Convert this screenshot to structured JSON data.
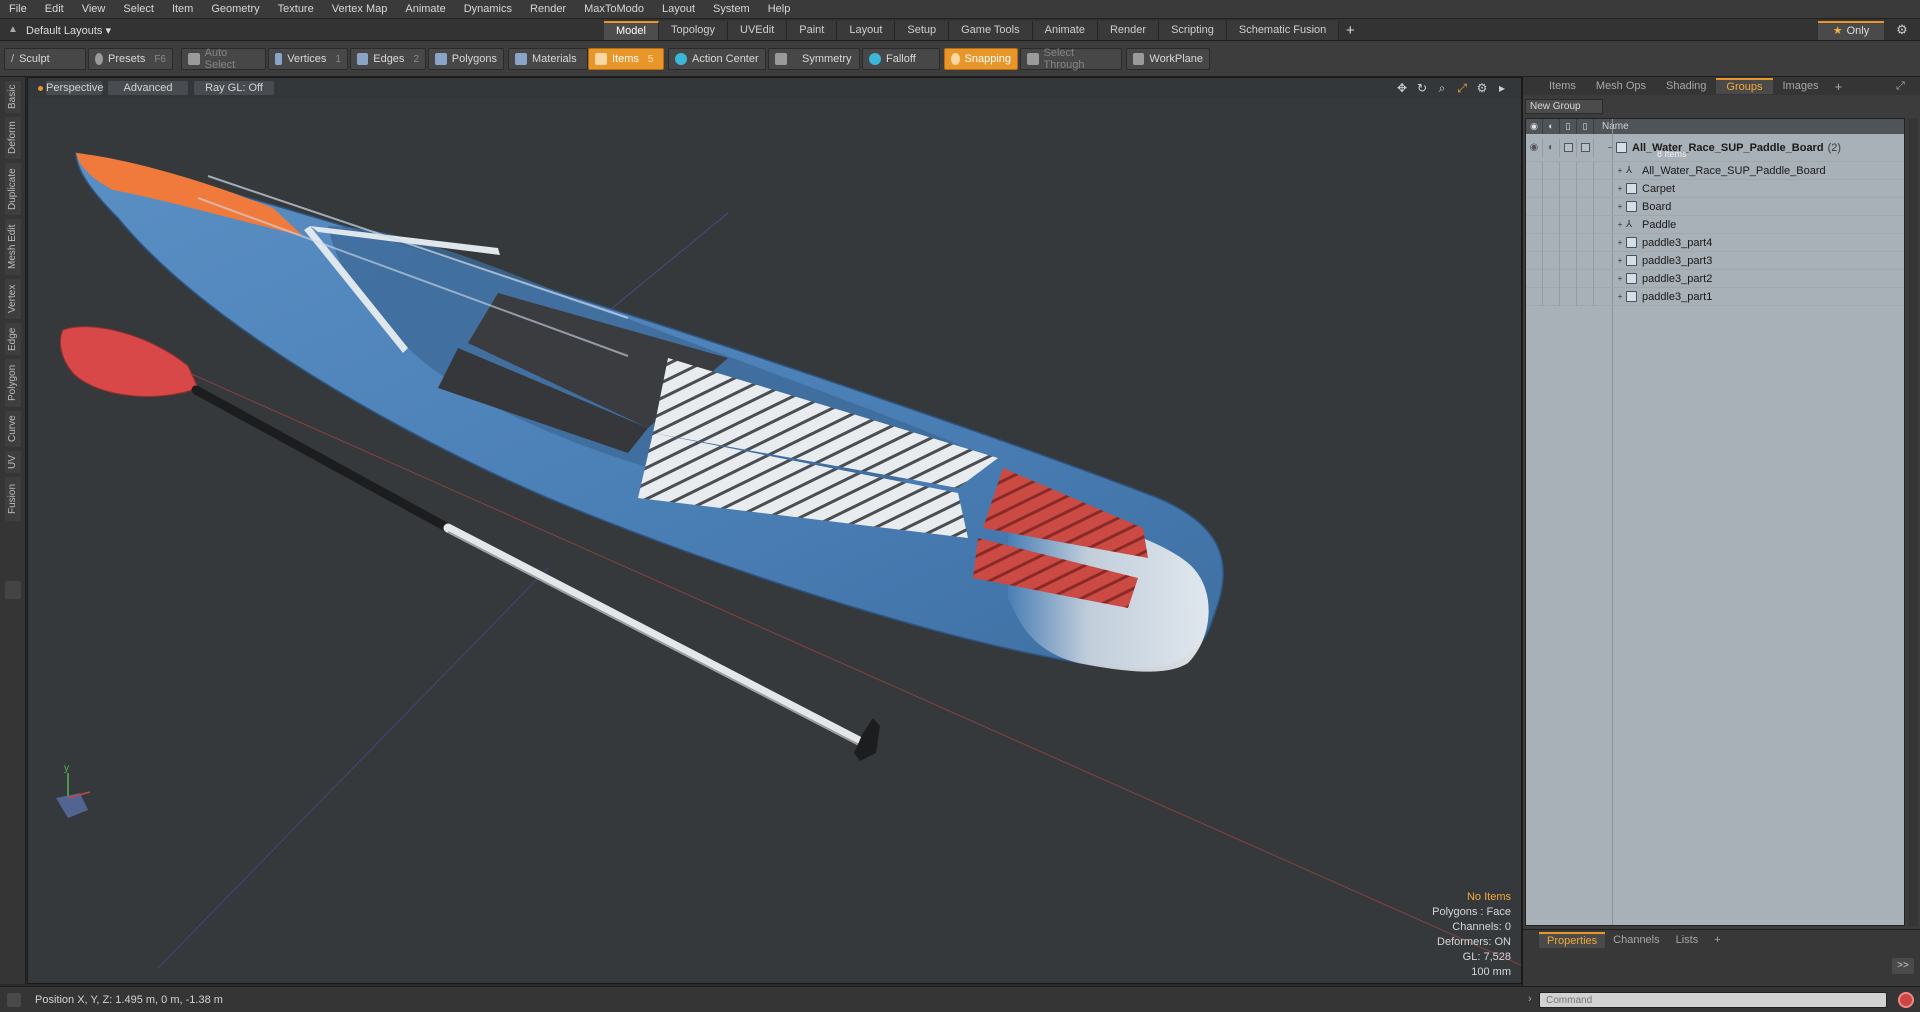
{
  "menu": [
    "File",
    "Edit",
    "View",
    "Select",
    "Item",
    "Geometry",
    "Texture",
    "Vertex Map",
    "Animate",
    "Dynamics",
    "Render",
    "MaxToModo",
    "Layout",
    "System",
    "Help"
  ],
  "layout_select": "Default Layouts ▾",
  "tabs": [
    "Model",
    "Topology",
    "UVEdit",
    "Paint",
    "Layout",
    "Setup",
    "Game Tools",
    "Animate",
    "Render",
    "Scripting",
    "Schematic Fusion"
  ],
  "active_tab": "Model",
  "only_label": "Only",
  "toolbar": {
    "sculpt": "Sculpt",
    "presets": "Presets",
    "presets_key": "F6",
    "auto_select": "Auto Select",
    "vertices": "Vertices",
    "vertices_key": "1",
    "edges": "Edges",
    "edges_key": "2",
    "polygons": "Polygons",
    "materials": "Materials",
    "items": "Items",
    "items_key": "5",
    "action_center": "Action Center",
    "symmetry": "Symmetry",
    "falloff": "Falloff",
    "snapping": "Snapping",
    "select_through": "Select Through",
    "workplane": "WorkPlane"
  },
  "left_tabs": [
    "Basic",
    "Deform",
    "Duplicate",
    "Mesh Edit",
    "Vertex",
    "Edge",
    "Polygon",
    "Curve",
    "UV",
    "Fusion"
  ],
  "viewport": {
    "perspective": "Perspective",
    "advanced": "Advanced",
    "raygl": "Ray GL: Off",
    "axis_y": "y",
    "stats": {
      "no_items": "No Items",
      "polygons": "Polygons : Face",
      "channels": "Channels: 0",
      "deformers": "Deformers: ON",
      "gl": "GL: 7,528",
      "scale": "100 mm"
    }
  },
  "status": "Position X, Y, Z:   1.495 m, 0 m, -1.38 m",
  "right_panel": {
    "tabs": [
      "Items",
      "Mesh Ops",
      "Shading",
      "Groups",
      "Images"
    ],
    "active_tab": "Groups",
    "new_group": "New Group",
    "name_header": "Name",
    "group": {
      "name": "All_Water_Race_SUP_Paddle_Board",
      "count": "(2)",
      "sub": "8 Items"
    },
    "items": [
      {
        "name": "All_Water_Race_SUP_Paddle_Board",
        "kind": "locator"
      },
      {
        "name": "Carpet",
        "kind": "mesh"
      },
      {
        "name": "Board",
        "kind": "mesh"
      },
      {
        "name": "Paddle",
        "kind": "locator"
      },
      {
        "name": "paddle3_part4",
        "kind": "mesh"
      },
      {
        "name": "paddle3_part3",
        "kind": "mesh"
      },
      {
        "name": "paddle3_part2",
        "kind": "mesh"
      },
      {
        "name": "paddle3_part1",
        "kind": "mesh"
      }
    ],
    "bottom_tabs": [
      "Properties",
      "Channels",
      "Lists"
    ],
    "bottom_active": "Properties",
    "expand_btn": ">>",
    "command_placeholder": "Command"
  },
  "colors": {
    "accent": "#e8962a",
    "board_blue": "#4a7fb6",
    "nose_orange": "#f07a3c",
    "pad_red": "#c8403a",
    "paddle_blade": "#d94848"
  }
}
